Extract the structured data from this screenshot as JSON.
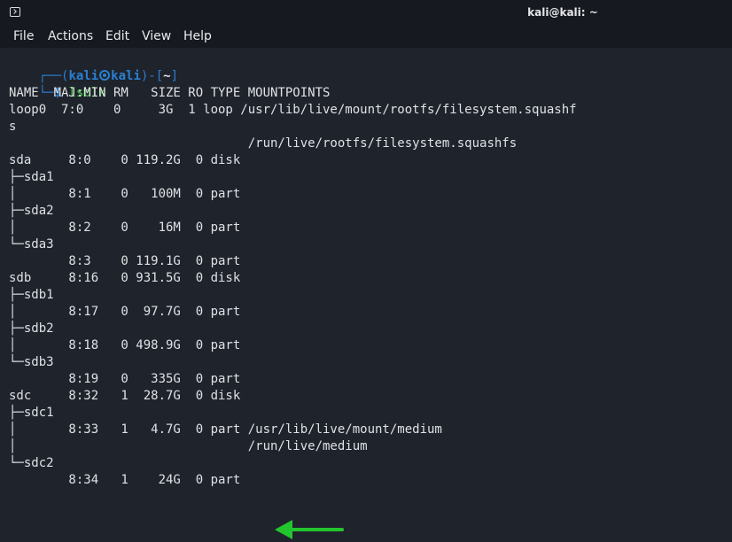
{
  "window": {
    "title": "kali@kali: ~"
  },
  "menu": [
    {
      "label": "File"
    },
    {
      "label": "Actions"
    },
    {
      "label": "Edit"
    },
    {
      "label": "View"
    },
    {
      "label": "Help"
    }
  ],
  "prompt": {
    "bracket_open": "┌──(",
    "user": "kali",
    "host": "kali",
    "mid": ")-[",
    "path": "~",
    "bracket_close": "]",
    "line2_prefix": "└─",
    "dollar": "$",
    "command": "lsblk"
  },
  "output": [
    "NAME  MAJ:MIN RM   SIZE RO TYPE MOUNTPOINTS",
    "loop0  7:0    0     3G  1 loop /usr/lib/live/mount/rootfs/filesystem.squashf",
    "s",
    "                                /run/live/rootfs/filesystem.squashfs",
    "sda     8:0    0 119.2G  0 disk",
    "├─sda1",
    "│       8:1    0   100M  0 part",
    "├─sda2",
    "│       8:2    0    16M  0 part",
    "└─sda3",
    "        8:3    0 119.1G  0 part",
    "sdb     8:16   0 931.5G  0 disk",
    "├─sdb1",
    "│       8:17   0  97.7G  0 part",
    "├─sdb2",
    "│       8:18   0 498.9G  0 part",
    "└─sdb3",
    "        8:19   0   335G  0 part",
    "sdc     8:32   1  28.7G  0 disk",
    "├─sdc1",
    "│       8:33   1   4.7G  0 part /usr/lib/live/mount/medium",
    "│                               /run/live/medium",
    "└─sdc2",
    "        8:34   1    24G  0 part"
  ],
  "colors": {
    "background": "#1f232b",
    "titlebar": "#16191f",
    "prompt_blue": "#2a7fd1",
    "command_green": "#3ec93a",
    "arrow_green": "#22c52e"
  },
  "icons": {
    "app": "terminal-icon",
    "annotation": "green-arrow-icon"
  }
}
